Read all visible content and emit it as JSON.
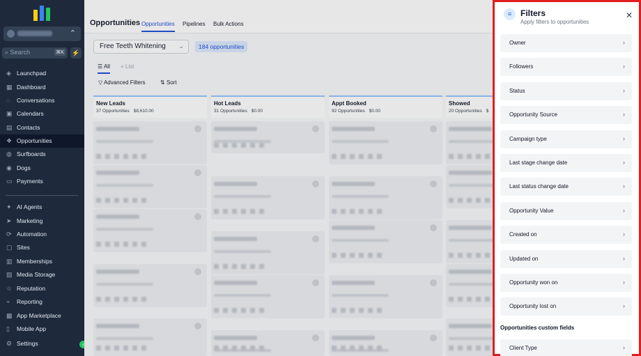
{
  "sidebar": {
    "search_label": "Search",
    "search_shortcut": "⌘K",
    "items": [
      {
        "label": "Launchpad",
        "icon": "rocket-icon"
      },
      {
        "label": "Dashboard",
        "icon": "dashboard-icon"
      },
      {
        "label": "Conversations",
        "icon": "chat-icon"
      },
      {
        "label": "Calendars",
        "icon": "calendar-icon"
      },
      {
        "label": "Contacts",
        "icon": "contacts-icon"
      },
      {
        "label": "Opportunities",
        "icon": "opportunities-icon",
        "active": true
      },
      {
        "label": "Surfboards",
        "icon": "surfboard-icon"
      },
      {
        "label": "Dogs",
        "icon": "paw-icon"
      },
      {
        "label": "Payments",
        "icon": "payments-icon"
      },
      {
        "label": "AI Agents",
        "icon": "sparkle-icon"
      },
      {
        "label": "Marketing",
        "icon": "send-icon"
      },
      {
        "label": "Automation",
        "icon": "automation-icon"
      },
      {
        "label": "Sites",
        "icon": "sites-icon"
      },
      {
        "label": "Memberships",
        "icon": "memberships-icon"
      },
      {
        "label": "Media Storage",
        "icon": "folder-icon"
      },
      {
        "label": "Reputation",
        "icon": "star-icon"
      },
      {
        "label": "Reporting",
        "icon": "chart-icon"
      },
      {
        "label": "App Marketplace",
        "icon": "grid-icon"
      },
      {
        "label": "Mobile App",
        "icon": "phone-icon"
      }
    ],
    "settings_label": "Settings"
  },
  "header": {
    "title": "Opportunities",
    "tabs": [
      "Opportunities",
      "Pipelines",
      "Bulk Actions"
    ]
  },
  "controls": {
    "pipeline": "Free Teeth Whitening",
    "count": "184 opportunities",
    "views": [
      "All",
      "List"
    ],
    "advanced_filters": "Advanced Filters",
    "sort": "Sort"
  },
  "columns": [
    {
      "name": "New Leads",
      "count": "37 Opportunities",
      "value": "$8,610.00"
    },
    {
      "name": "Hot Leads",
      "count": "31 Opportunities",
      "value": "$0.00"
    },
    {
      "name": "Appt Booked",
      "count": "92 Opportunities",
      "value": "$0.00"
    },
    {
      "name": "Showed",
      "count": "20 Opportunities",
      "value": "$"
    }
  ],
  "filters": {
    "title": "Filters",
    "subtitle": "Apply filters to opportunities",
    "items": [
      "Owner",
      "Followers",
      "Status",
      "Opportunity Source",
      "Campaign type",
      "Last stage change date",
      "Last status change date",
      "Opportunity Value",
      "Created on",
      "Updated on",
      "Opportunity won on",
      "Opportunity lost on"
    ],
    "custom_section": "Opportunities custom fields",
    "custom_items": [
      "Client Type"
    ]
  },
  "colors": {
    "sidebar_bg": "#1e293b",
    "accent": "#1d4ed8",
    "highlight_border": "#e11d1d"
  }
}
